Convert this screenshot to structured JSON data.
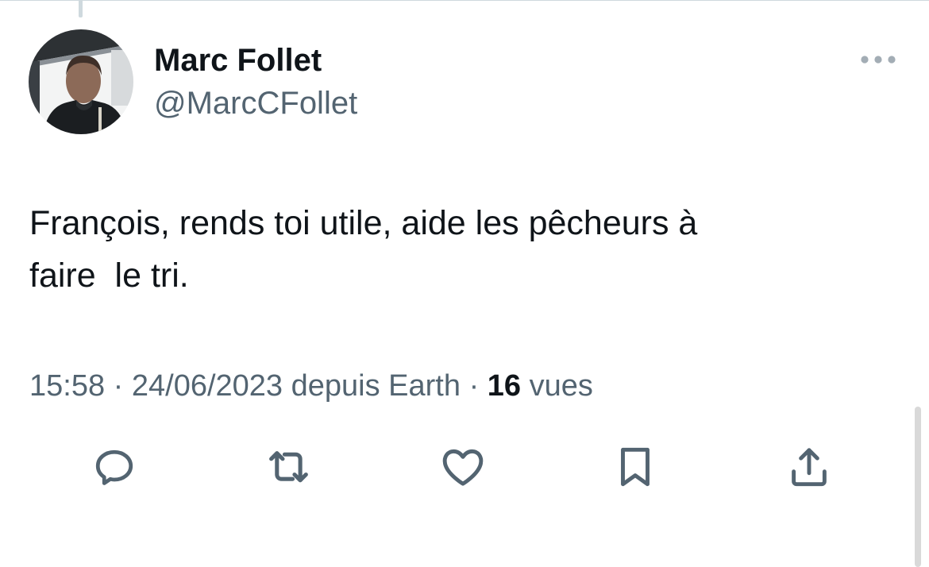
{
  "tweet": {
    "author": {
      "display_name": "Marc Follet",
      "handle": "@MarcCFollet"
    },
    "text": "François, rends toi utile, aide les pêcheurs à\nfaire  le tri.",
    "time": "15:58",
    "separator": "·",
    "date": "24/06/2023",
    "source_prefix": "depuis",
    "source": "Earth",
    "views_count": "16",
    "views_label": "vues"
  },
  "actions": [
    {
      "name": "reply",
      "icon": "reply-icon"
    },
    {
      "name": "retweet",
      "icon": "retweet-icon"
    },
    {
      "name": "like",
      "icon": "heart-icon"
    },
    {
      "name": "bookmark",
      "icon": "bookmark-icon"
    },
    {
      "name": "share",
      "icon": "share-icon"
    }
  ],
  "colors": {
    "text": "#0f1419",
    "secondary": "#536471",
    "border": "#cfd9de"
  }
}
